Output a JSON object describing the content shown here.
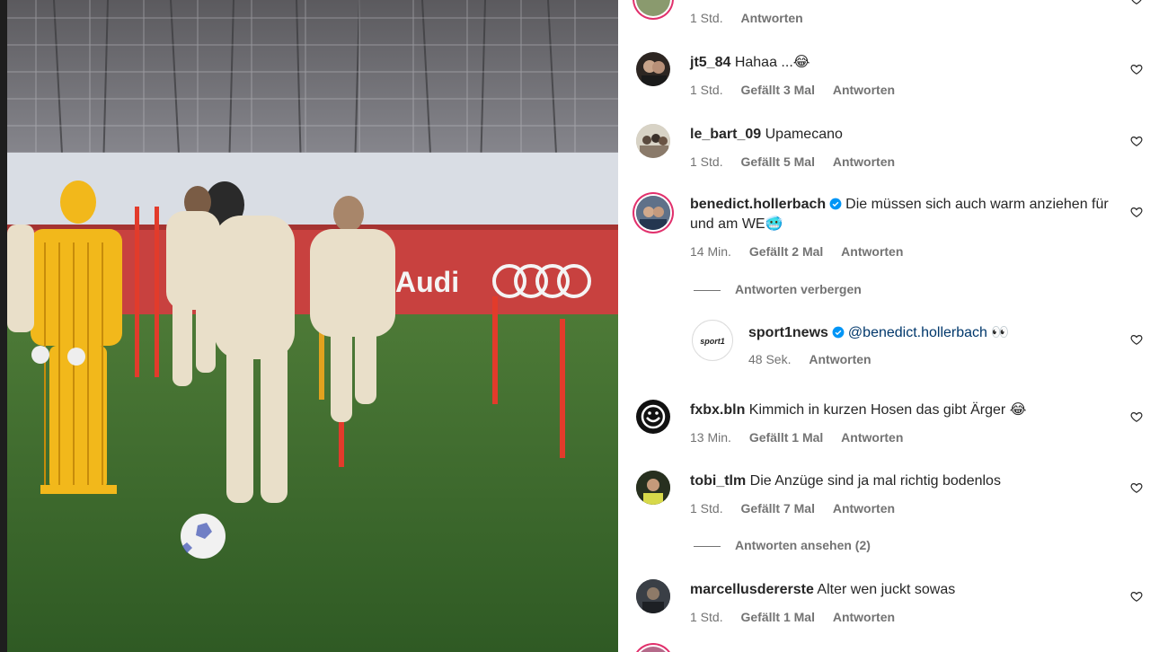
{
  "comments": [
    {
      "username": "",
      "text": "",
      "time": "1 Std.",
      "likes": "",
      "reply_label": "Antworten"
    },
    {
      "username": "jt5_84",
      "text": "Hahaa ...😂",
      "time": "1 Std.",
      "likes": "Gefällt 3 Mal",
      "reply_label": "Antworten"
    },
    {
      "username": "le_bart_09",
      "text": "Upamecano",
      "time": "1 Std.",
      "likes": "Gefällt 5 Mal",
      "reply_label": "Antworten"
    },
    {
      "username": "benedict.hollerbach",
      "text": "Die müssen sich auch warm anziehen für und am WE🥶",
      "time": "14 Min.",
      "likes": "Gefällt 2 Mal",
      "reply_label": "Antworten",
      "toggle_label": "Antworten verbergen",
      "reply": {
        "username": "sport1news",
        "mention": "@benedict.hollerbach",
        "text": "👀",
        "time": "48 Sek.",
        "reply_label": "Antworten"
      }
    },
    {
      "username": "fxbx.bln",
      "text": "Kimmich in kurzen Hosen das gibt Ärger 😂",
      "time": "13 Min.",
      "likes": "Gefällt 1 Mal",
      "reply_label": "Antworten"
    },
    {
      "username": "tobi_tlm",
      "text": "Die Anzüge sind ja mal richtig bodenlos",
      "time": "1 Std.",
      "likes": "Gefällt 7 Mal",
      "reply_label": "Antworten",
      "toggle_label": "Antworten ansehen (2)"
    },
    {
      "username": "marcellusdererste",
      "text": "Alter wen juckt sowas",
      "time": "1 Std.",
      "likes": "Gefällt 1 Mal",
      "reply_label": "Antworten"
    }
  ],
  "media": {
    "banner_text": "Audi",
    "icons": {
      "like": "heart-icon",
      "verified": "verified-badge-icon"
    }
  },
  "colors": {
    "verified": "#0095f6",
    "meta_text": "#737373",
    "primary_text": "#262626"
  }
}
